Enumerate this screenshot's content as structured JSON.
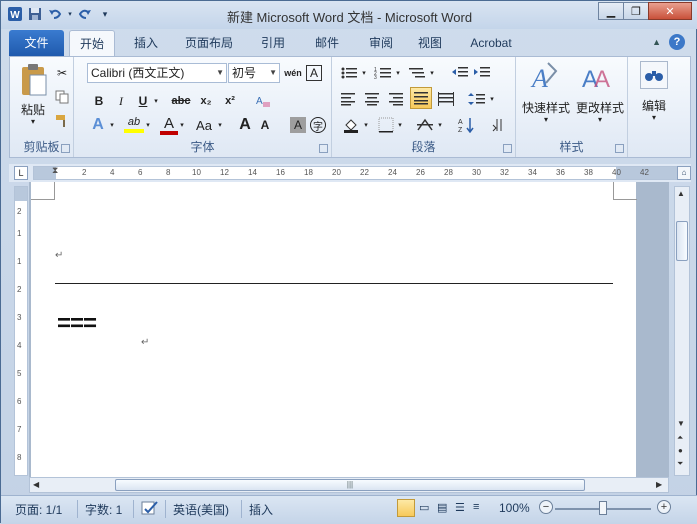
{
  "title": "新建 Microsoft Word 文档 - Microsoft Word",
  "window_buttons": {
    "minimize": "▁",
    "restore": "❐",
    "close": "✕"
  },
  "tabs": [
    {
      "label": "文件"
    },
    {
      "label": "开始"
    },
    {
      "label": "插入"
    },
    {
      "label": "页面布局"
    },
    {
      "label": "引用"
    },
    {
      "label": "邮件"
    },
    {
      "label": "审阅"
    },
    {
      "label": "视图"
    },
    {
      "label": "Acrobat"
    }
  ],
  "help_label": "?",
  "ribbon": {
    "clipboard": {
      "paste": "粘贴",
      "label": "剪贴板"
    },
    "font": {
      "font_name": "Calibri (西文正文)",
      "font_size": "初号",
      "wen": "wén",
      "A_box": "A",
      "bold": "B",
      "italic": "I",
      "underline": "U",
      "strike": "abc",
      "sub": "x₂",
      "sup": "x²",
      "text_effect": "A",
      "highlight": "ab",
      "font_color": "A",
      "case": "Aa",
      "grow": "A",
      "shrink": "A",
      "shade": "A",
      "circle": "字",
      "label": "字体"
    },
    "paragraph": {
      "label": "段落"
    },
    "styles": {
      "quick": "快速样式",
      "change": "更改样式",
      "label": "样式"
    },
    "edit": {
      "label": "编辑"
    }
  },
  "ruler": {
    "corner": "L",
    "ticks": [
      "2",
      "4",
      "6",
      "8",
      "10",
      "12",
      "14",
      "16",
      "18",
      "20",
      "22",
      "24",
      "26",
      "28",
      "30",
      "32",
      "34",
      "36",
      "38",
      "40",
      "42"
    ],
    "vticks": [
      "2",
      "1",
      "1",
      "2",
      "3",
      "4",
      "5",
      "6",
      "7",
      "8",
      "9",
      "10",
      "11"
    ]
  },
  "document": {
    "para_mark": "↵",
    "equals_text": "===",
    "para_mark2": "↵"
  },
  "status": {
    "page": "页面: 1/1",
    "words": "字数: 1",
    "language": "英语(美国)",
    "mode": "插入",
    "zoom": "100%",
    "zoom_minus": "−",
    "zoom_plus": "+"
  }
}
